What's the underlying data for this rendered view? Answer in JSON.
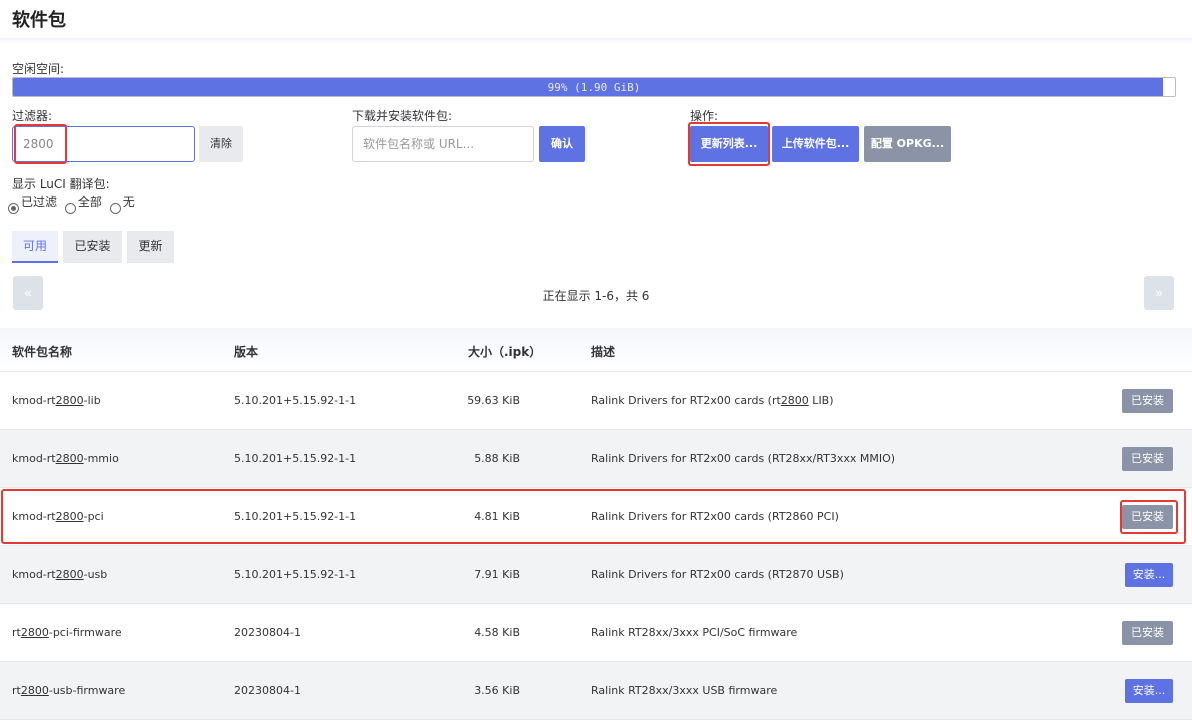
{
  "page": {
    "title": "软件包"
  },
  "space": {
    "label": "空闲空间:",
    "text": "99% (1.90 GiB)",
    "percent": 99,
    "fill_color": "#5e72e4"
  },
  "filter": {
    "label": "过滤器:",
    "value": "2800",
    "clear_label": "清除"
  },
  "download": {
    "label": "下载并安装软件包:",
    "placeholder": "软件包名称或 URL...",
    "confirm_label": "确认"
  },
  "actions": {
    "label": "操作:",
    "update_label": "更新列表...",
    "upload_label": "上传软件包...",
    "config_label": "配置 OPKG..."
  },
  "translation": {
    "label": "显示 LuCI 翻译包:",
    "options": [
      {
        "label": "已过滤",
        "checked": true
      },
      {
        "label": "全部",
        "checked": false
      },
      {
        "label": "无",
        "checked": false
      }
    ]
  },
  "tabs": [
    {
      "label": "可用",
      "active": true
    },
    {
      "label": "已安装",
      "active": false
    },
    {
      "label": "更新",
      "active": false
    }
  ],
  "pager": {
    "prev": "«",
    "next": "»",
    "text": "正在显示 1-6，共 6"
  },
  "table": {
    "headers": {
      "name": "软件包名称",
      "version": "版本",
      "size": "大小（.ipk）",
      "description": "描述"
    },
    "filter_term": "2800",
    "rows": [
      {
        "name": "kmod-rt2800-lib",
        "version": "5.10.201+5.15.92-1-1",
        "size": "59.63 KiB",
        "description": "Ralink Drivers for RT2x00 cards (rt2800 LIB)",
        "action": "已安装",
        "installed": true
      },
      {
        "name": "kmod-rt2800-mmio",
        "version": "5.10.201+5.15.92-1-1",
        "size": "5.88 KiB",
        "description": "Ralink Drivers for RT2x00 cards (RT28xx/RT3xxx MMIO)",
        "action": "已安装",
        "installed": true
      },
      {
        "name": "kmod-rt2800-pci",
        "version": "5.10.201+5.15.92-1-1",
        "size": "4.81 KiB",
        "description": "Ralink Drivers for RT2x00 cards (RT2860 PCI)",
        "action": "已安装",
        "installed": true
      },
      {
        "name": "kmod-rt2800-usb",
        "version": "5.10.201+5.15.92-1-1",
        "size": "7.91 KiB",
        "description": "Ralink Drivers for RT2x00 cards (RT2870 USB)",
        "action": "安装...",
        "installed": false
      },
      {
        "name": "rt2800-pci-firmware",
        "version": "20230804-1",
        "size": "4.58 KiB",
        "description": "Ralink RT28xx/3xxx PCI/SoC firmware",
        "action": "已安装",
        "installed": true
      },
      {
        "name": "rt2800-usb-firmware",
        "version": "20230804-1",
        "size": "3.56 KiB",
        "description": "Ralink RT28xx/3xxx USB firmware",
        "action": "安装...",
        "installed": false
      }
    ]
  },
  "colors": {
    "accent": "#5e72e4",
    "installed_button": "#8a94a6",
    "highlight": "#e53935"
  }
}
